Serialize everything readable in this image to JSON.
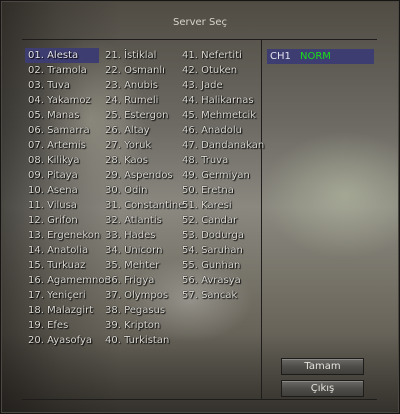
{
  "window": {
    "title": "Server Seç"
  },
  "servers": {
    "column1": [
      "01. Alesta",
      "02. Tramola",
      "03. Tuva",
      "04. Yakamoz",
      "05. Manas",
      "06. Samarra",
      "07. Artemis",
      "08. Kilikya",
      "09. Pitaya",
      "10. Asena",
      "11. Vilusa",
      "12. Grifon",
      "13. Ergenekon",
      "14. Anatolia",
      "15. Turkuaz",
      "16. Agamemnon",
      "17. Yeniçeri",
      "18. Malazgirt",
      "19. Efes",
      "20. Ayasofya"
    ],
    "column2": [
      "21. İstiklal",
      "22. Osmanlı",
      "23. Anubis",
      "24. Rumeli",
      "25. Estergon",
      "26. Altay",
      "27. Yoruk",
      "28. Kaos",
      "29. Aspendos",
      "30. Odin",
      "31. Constantine",
      "32. Atlantis",
      "33. Hades",
      "34. Unicorn",
      "35. Mehter",
      "36. Frigya",
      "37. Olympos",
      "38. Pegasus",
      "39. Kripton",
      "40. Turkistan"
    ],
    "column3": [
      "41. Nefertiti",
      "42. Otuken",
      "43. Jade",
      "44. Halikarnas",
      "45. Mehmetcik",
      "46. Anadolu",
      "47. Dandanakan",
      "48. Truva",
      "49. Germiyan",
      "50. Eretna",
      "51. Karesi",
      "52. Candar",
      "53. Dodurga",
      "54. Saruhan",
      "55. Gunhan",
      "56. Avrasya",
      "57. Sancak"
    ],
    "selected": "01. Alesta"
  },
  "channel": {
    "name": "CH1",
    "status": "NORM",
    "status_color": "#18e018"
  },
  "buttons": {
    "ok_label": "Tamam",
    "exit_label": "Çıkış"
  },
  "colors": {
    "selection": "#3e3d72"
  }
}
